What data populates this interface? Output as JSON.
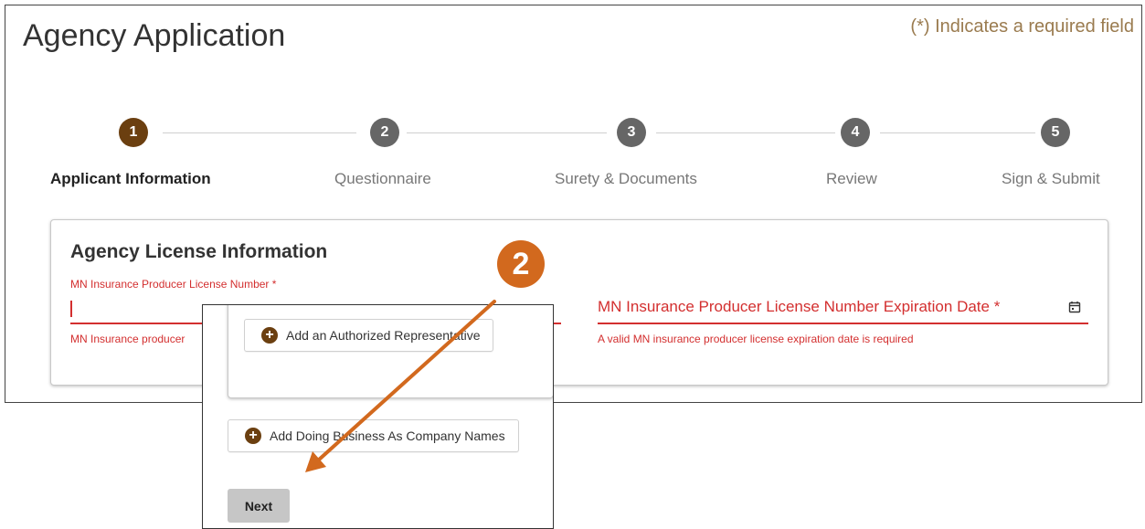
{
  "header": {
    "title": "Agency Application",
    "required_note": "(*) Indicates a required field"
  },
  "stepper": {
    "steps": [
      {
        "number": "1",
        "label": "Applicant Information",
        "active": true
      },
      {
        "number": "2",
        "label": "Questionnaire",
        "active": false
      },
      {
        "number": "3",
        "label": "Surety & Documents",
        "active": false
      },
      {
        "number": "4",
        "label": "Review",
        "active": false
      },
      {
        "number": "5",
        "label": "Sign & Submit",
        "active": false
      }
    ]
  },
  "license_card": {
    "title": "Agency License Information",
    "license_number": {
      "label": "MN Insurance Producer License Number *",
      "value": "",
      "error": "MN Insurance producer"
    },
    "expiration": {
      "label": "MN Insurance Producer License Number Expiration Date *",
      "error": "A valid MN insurance producer license expiration date is required",
      "icon": "calendar-icon"
    }
  },
  "overlay": {
    "add_rep_label": "Add an Authorized Representative",
    "add_dba_label": "Add Doing Business As Company Names",
    "next_label": "Next"
  },
  "annotation": {
    "badge_number": "2",
    "color": "#d2691e"
  },
  "colors": {
    "accent": "#6b3f10",
    "error": "#d32f2f",
    "required_note": "#9a7b4f",
    "step_inactive": "#666666"
  }
}
